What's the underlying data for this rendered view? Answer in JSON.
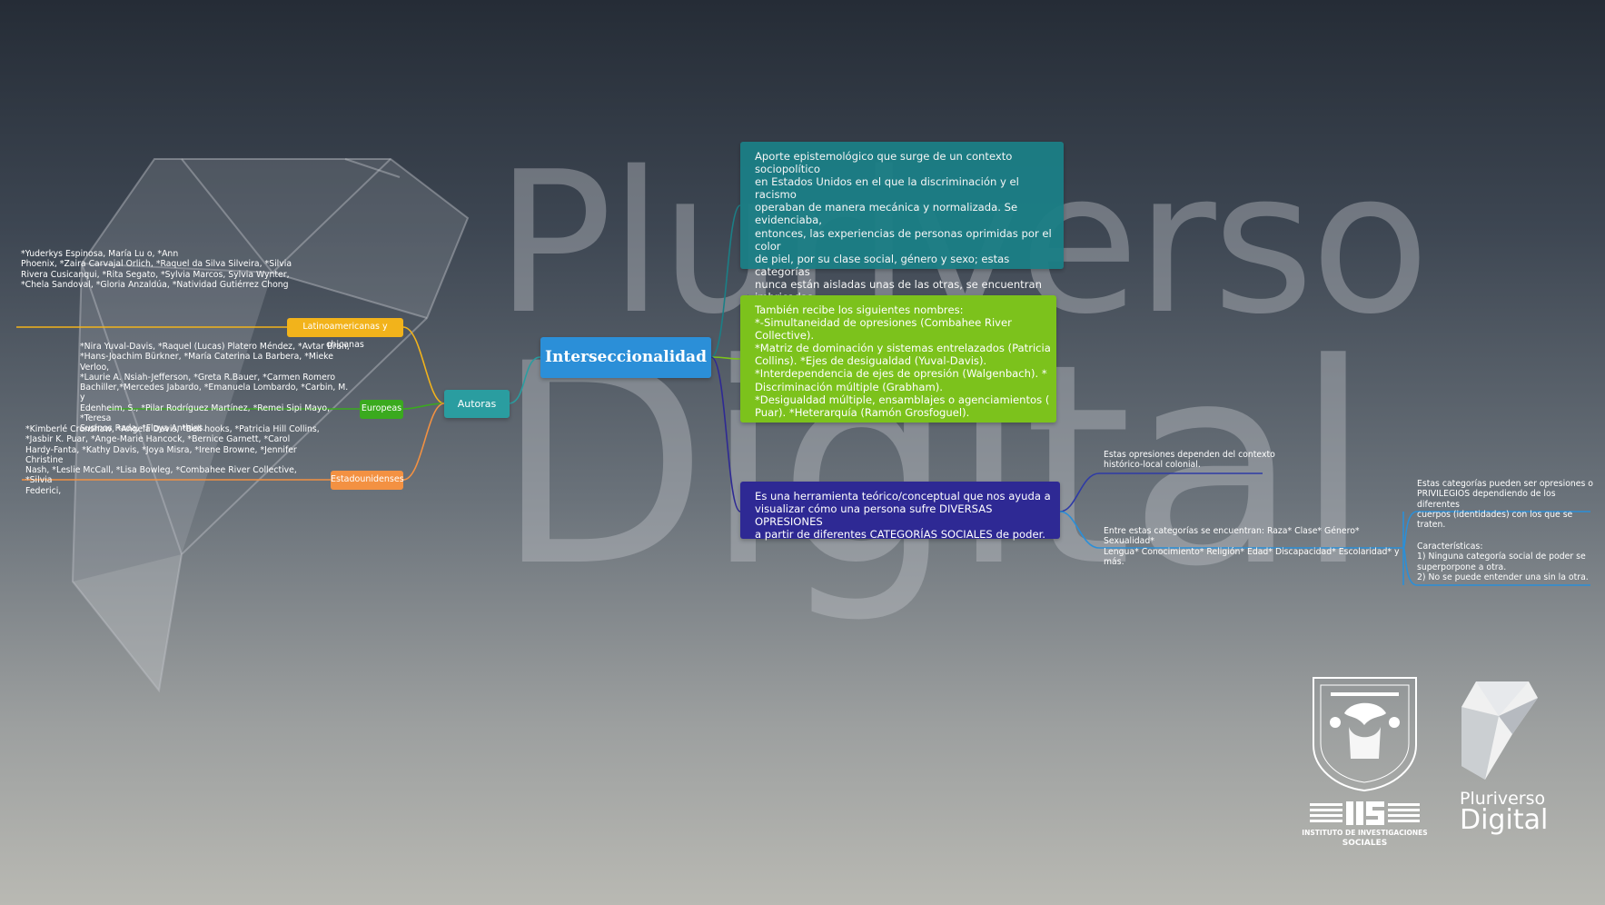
{
  "watermark": {
    "line1": "Pluriverso",
    "line2": "Digital"
  },
  "central": {
    "label": "Interseccionalidad",
    "color": "#2b8fd8"
  },
  "authors": {
    "label": "Autoras",
    "color": "#2a9da0",
    "groups": [
      {
        "label": "Latinoamericanas y chicanas",
        "color": "#f2b31b",
        "names": "*Yuderkys Espinosa, María Lu   o, *Ann\nPhoenix, *Zaira Carvajal Orlich, *Raquel da Silva Silveira, *Silvia\nRivera Cusicanqui, *Rita Segato, *Sylvia Marcos, Sylvia Wynter,\n*Chela Sandoval, *Gloria Anzaldúa, *Natividad Gutiérrez Chong"
      },
      {
        "label": "Europeas",
        "color": "#3aaa1e",
        "names": "*Nira Yuval-Davis, *Raquel (Lucas) Platero Méndez, *Avtar Brah,\n*Hans-Joachim Bürkner, *María Caterina La Barbera, *Mieke Verloo,\n*Laurie A. Nsiah-Jefferson, *Greta R.Bauer, *Carmen Romero\nBachiller,*Mercedes Jabardo, *Emanuela Lombardo, *Carbin, M. y\nEdenheim, S., *Pilar Rodríguez Martínez, *Remei Sipi Mayo, *Teresa\nSusinos Rada, *Floya Anthias."
      },
      {
        "label": "Estadounidenses",
        "color": "#f39142",
        "names": "*Kimberlé Crenshaw, *Angela Davis, *Bell hooks, *Patricia Hill Collins,\n*Jasbir K. Puar, *Ange-Marie Hancock, *Bernice Garnett, *Carol\nHardy-Fanta, *Kathy Davis, *Joya Misra, *Irene Browne, *Jennifer Christine\nNash, *Leslie McCall, *Lisa Bowleg, *Combahee River Collective, *Silvia\nFederici,"
      }
    ]
  },
  "topics": [
    {
      "color": "#1b7f86",
      "text": "Aporte epistemológico que surge de un contexto sociopolítico\nen Estados Unidos en el que la discriminación y el racismo\noperaban de manera mecánica y normalizada. Se\nevidenciaba,\nentonces, las experiencias de personas oprimidas por el color\nde piel, por su clase social, género y sexo; estas categorías\nnunca están aisladas unas de las otras, se encuentran\nimbricadas."
    },
    {
      "color": "#7cc21c",
      "text": "También recibe los siguientes nombres:\n*-Simultaneidad de opresiones (Combahee River Collective).\n*Matriz de dominación y sistemas entrelazados (Patricia\nCollins). *Ejes de desigualdad (Yuval-Davis).\n*Interdependencia de ejes de opresión (Walgenbach). *\nDiscriminación múltiple (Grabham).\n*Desigualdad múltiple, ensamblajes o agenciamientos (\nPuar). *Heterarquía (Ramón Grosfoguel)."
    },
    {
      "color": "#2e2994",
      "text": "Es una herramienta teórico/conceptual que nos ayuda a\nvisualizar cómo una persona sufre DIVERSAS OPRESIONES\na partir de diferentes CATEGORÍAS SOCIALES de poder."
    }
  ],
  "subtopics": [
    {
      "text": "Estas opresiones dependen del contexto\nhistórico-local colonial."
    },
    {
      "text": "Entre estas categorías se encuentran: Raza* Clase* Género* Sexualidad*\nLengua* Conocimiento* Religión* Edad* Discapacidad* Escolaridad* y más."
    }
  ],
  "details": [
    {
      "text": "Estas categorías pueden ser opresiones o\nPRIVILEGIOS dependiendo de los diferentes\ncuerpos (identidades) con los que se traten."
    },
    {
      "text": "Características:\n1) Ninguna categoría social de poder se\nsuperporpone a otra.\n2) No se puede entender una sin la otra."
    }
  ],
  "logos": {
    "iis_caption_1": "INSTITUTO DE INVESTIGACIONES",
    "iis_caption_2": "SOCIALES",
    "brand_1": "Pluriverso",
    "brand_2": "Digital"
  }
}
